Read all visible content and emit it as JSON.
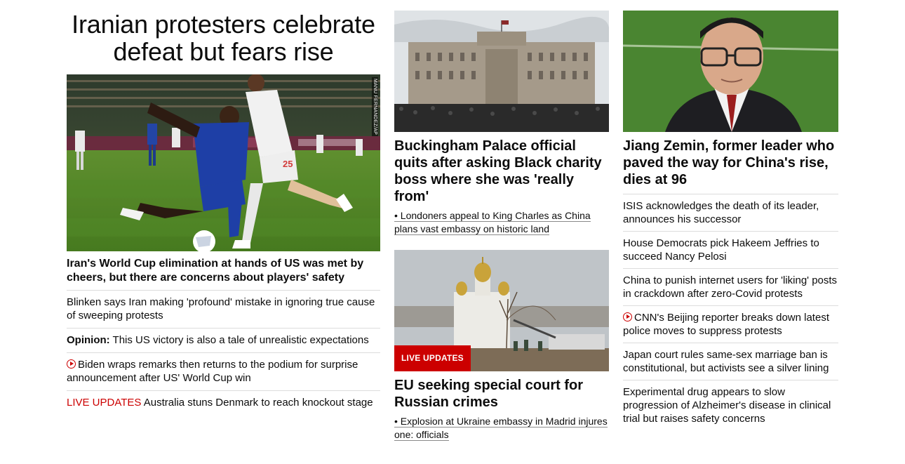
{
  "lead": {
    "headline": "Iranian protesters celebrate defeat but fears rise",
    "photo_credit": "MANU FERNANDEZ/AP",
    "image_alt": "soccer-match-photo",
    "story_headline": "Iran's World Cup elimination at hands of US was met by cheers, but there are concerns about players' safety",
    "links": [
      {
        "text": "Blinken says Iran making 'profound' mistake in ignoring true cause of sweeping protests"
      },
      {
        "label": "Opinion:",
        "text": " This US victory is also a tale of unrealistic expectations"
      },
      {
        "icon": "play-icon",
        "text": "Biden wraps remarks then returns to the podium for surprise announcement after US' World Cup win"
      },
      {
        "label": "LIVE UPDATES",
        "text": " Australia stuns Denmark to reach knockout stage"
      }
    ]
  },
  "middle": {
    "story1": {
      "headline": "Buckingham Palace official quits after asking Black charity boss where she was 'really from'",
      "sub_link": "Londoners appeal to King Charles as China plans vast embassy on historic land"
    },
    "story2": {
      "badge": "LIVE UPDATES",
      "headline": "EU seeking special court for Russian crimes",
      "sub_link": "Explosion at Ukraine embassy in Madrid injures one: officials"
    }
  },
  "right": {
    "headline": "Jiang Zemin, former leader who paved the way for China's rise, dies at 96",
    "links": [
      {
        "text": "ISIS acknowledges the death of its leader, announces his successor"
      },
      {
        "text": "House Democrats pick Hakeem Jeffries to succeed Nancy Pelosi"
      },
      {
        "text": "China to punish internet users for 'liking' posts in crackdown after zero-Covid protests"
      },
      {
        "icon": "play-icon",
        "text": "CNN's Beijing reporter breaks down latest police moves to suppress protests"
      },
      {
        "text": "Japan court rules same-sex marriage ban is constitutional, but activists see a silver lining"
      },
      {
        "text": "Experimental drug appears to slow progression of Alzheimer's disease in clinical trial but raises safety concerns"
      }
    ]
  },
  "colors": {
    "accent_red": "#cc0000",
    "divider": "#dcdcdc",
    "text": "#0c0c0c"
  }
}
